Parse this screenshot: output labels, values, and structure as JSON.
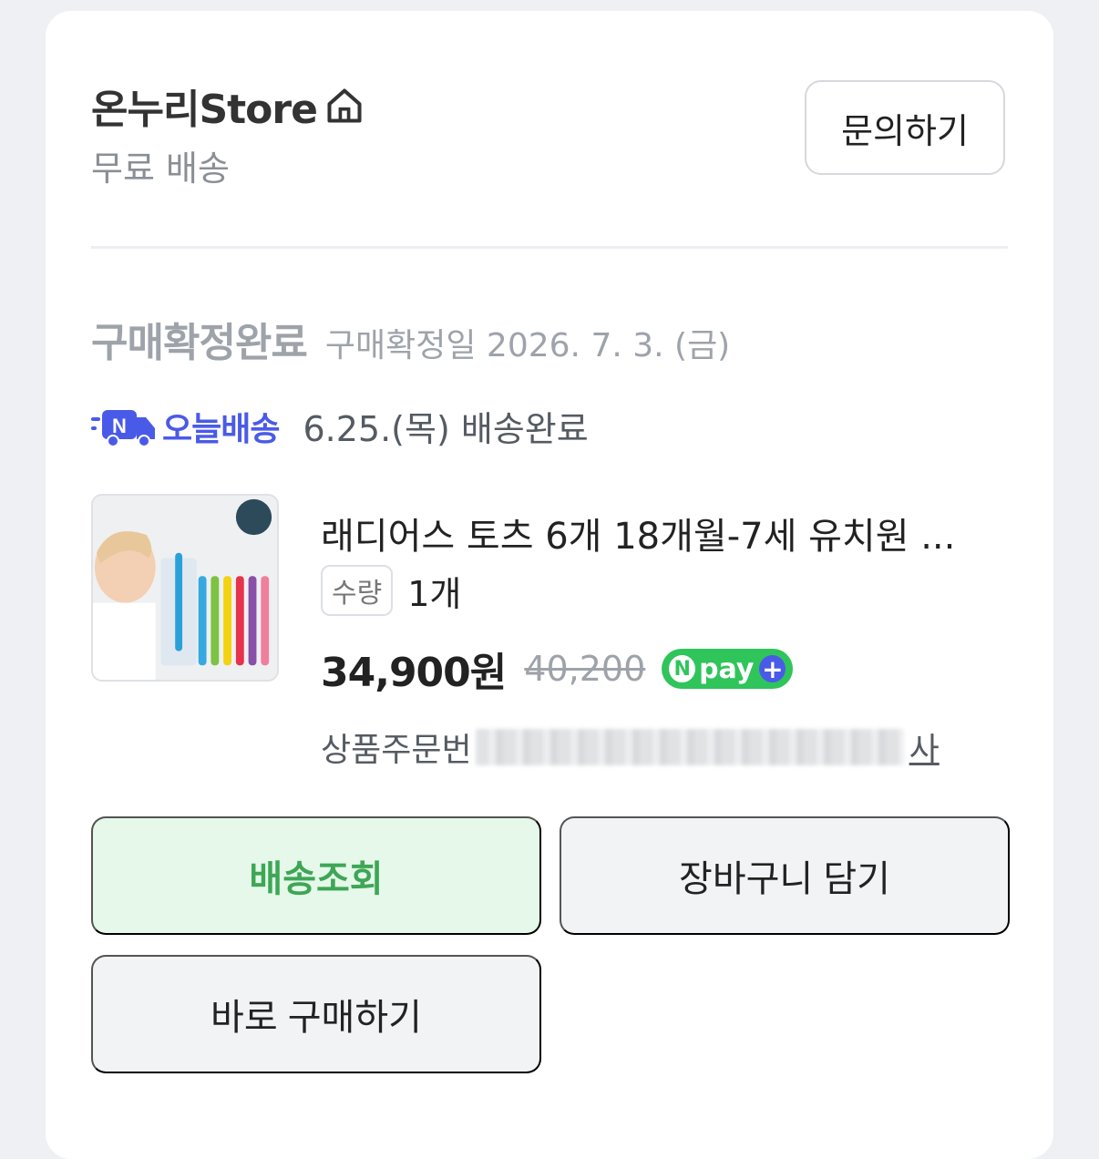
{
  "store": {
    "name": "온누리Store",
    "shipping": "무료 배송",
    "inquiry_label": "문의하기"
  },
  "status": {
    "main": "구매확정완료",
    "sub": "구매확정일 2026. 7. 3. (금)"
  },
  "delivery": {
    "badge": "오늘배송",
    "text": "6.25.(목) 배송완료"
  },
  "product": {
    "title": "래디어스 토츠 6개 18개월-7세 유치원 ...",
    "qty_label": "수량",
    "qty_value": "1개",
    "price": "34,900원",
    "original_price": "40,200",
    "npay_label": "pay",
    "order_label": "상품주문번",
    "copy_label": "사"
  },
  "actions": {
    "track": "배송조회",
    "cart": "장바구니 담기",
    "buy": "바로 구매하기"
  },
  "colors": {
    "accent_green": "#3ea655",
    "npay_green": "#2fc55b",
    "today_blue": "#4a5ae8"
  }
}
